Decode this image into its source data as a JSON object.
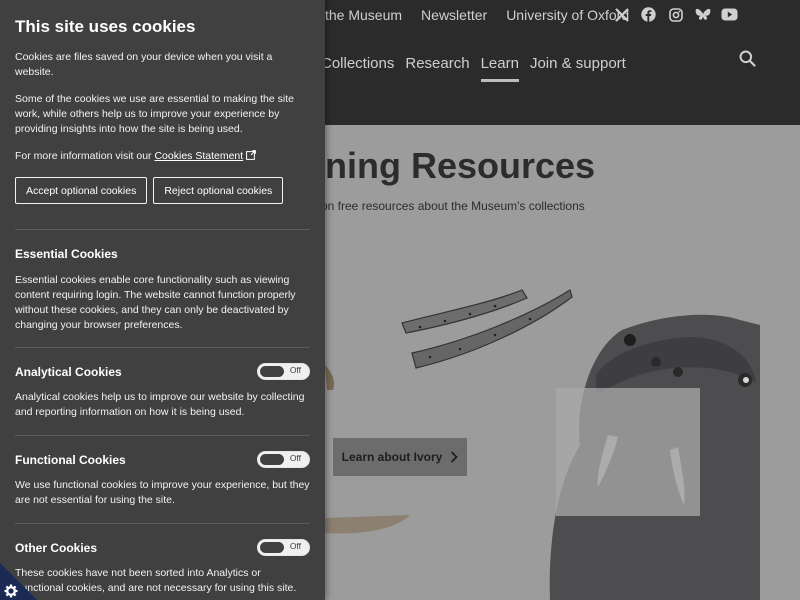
{
  "site": {
    "top_nav": [
      "the Museum",
      "Newsletter",
      "University of Oxford"
    ],
    "social_icons": [
      "x-icon",
      "facebook-icon",
      "instagram-icon",
      "bluesky-icon",
      "youtube-icon"
    ],
    "main_nav": [
      {
        "label": "Collections",
        "active": false
      },
      {
        "label": "Research",
        "active": false
      },
      {
        "label": "Learn",
        "active": true
      },
      {
        "label": "Join & support",
        "active": false
      }
    ],
    "page_title": "ning Resources",
    "page_subtitle": "on free resources about the Museum's collections",
    "ivory_button": "Learn about Ivory"
  },
  "cookie_panel": {
    "title": "This site uses cookies",
    "intro": "Cookies are files saved on your device when you visit a website.",
    "body": "Some of the cookies we use are essential to making the site work, while others help us to improve your experience by providing insights into how the site is being used.",
    "more_info_prefix": "For more information visit our ",
    "statement_link": "Cookies Statement",
    "accept_label": "Accept optional cookies",
    "reject_label": "Reject optional cookies",
    "sections": [
      {
        "title": "Essential Cookies",
        "has_toggle": false,
        "toggle_label": "",
        "text": "Essential cookies enable core functionality such as viewing content requiring login. The website cannot function properly without these cookies, and they can only be deactivated by changing your browser preferences."
      },
      {
        "title": "Analytical Cookies",
        "has_toggle": true,
        "toggle_label": "Off",
        "text": "Analytical cookies help us to improve our website by collecting and reporting information on how it is being used."
      },
      {
        "title": "Functional Cookies",
        "has_toggle": true,
        "toggle_label": "Off",
        "text": "We use functional cookies to improve your experience, but they are not essential for using the site."
      },
      {
        "title": "Other Cookies",
        "has_toggle": true,
        "toggle_label": "Off",
        "text": "These cookies have not been sorted into Analytics or Functional cookies, and are not necessary for using this site."
      }
    ]
  },
  "colors": {
    "panel_bg": "#404040",
    "header_bg": "#2b2b2b",
    "overlay_bg": "#9c9c9c",
    "settings_tab": "#1a2a55"
  }
}
